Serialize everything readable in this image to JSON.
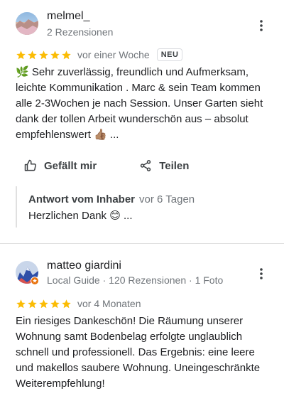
{
  "reviews": [
    {
      "author": "melmel_",
      "meta": "2 Rezensionen",
      "time": "vor einer Woche",
      "badge": "NEU",
      "rating": 5,
      "text": "🌿 Sehr zuverlässig, freundlich und Aufmerksam, leichte Kommunikation . Marc & sein Team kommen alle 2-3Wochen je nach Session. Unser Garten sieht dank der tollen Arbeit wunderschön aus – absolut empfehlenswert 👍🏽 ...",
      "actions": {
        "like": "Gefällt mir",
        "share": "Teilen"
      },
      "owner_reply": {
        "title": "Antwort vom Inhaber",
        "time": "vor 6 Tagen",
        "text": "Herzlichen Dank 😊 ..."
      },
      "avatar_icon": "landscape-avatar"
    },
    {
      "author": "matteo giardini",
      "meta": "Local Guide · 120 Rezensionen · 1 Foto",
      "time": "vor 4 Monaten",
      "rating": 5,
      "text": "Ein riesiges Dankeschön! Die Räumung unserer Wohnung samt Bodenbelag erfolgte unglaublich schnell und professionell. Das Ergebnis: eine leere und makellos saubere Wohnung. Uneingeschränkte Weiterempfehlung!",
      "avatar_icon": "mountain-avatar",
      "local_guide_badge_icon": "local-guide-badge-icon"
    }
  ],
  "colors": {
    "star": "#fbbc04",
    "text": "#202124",
    "secondary": "#70757a",
    "divider": "#e0e0e0"
  }
}
